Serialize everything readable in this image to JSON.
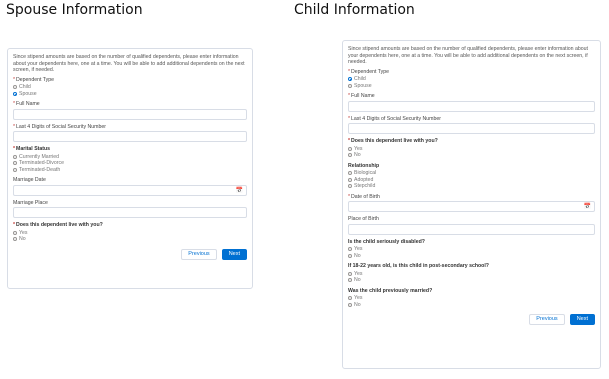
{
  "spouse": {
    "heading": "Spouse Information",
    "intro": "Since stipend amounts are based on the number of qualified dependents, please enter information about your dependents here, one at a time. You will be able to add additional dependents on the next screen, if needed.",
    "dependent_type": {
      "label": "Dependent Type",
      "options": [
        "Child",
        "Spouse"
      ],
      "selected": "Spouse"
    },
    "full_name_label": "Full Name",
    "ssn_label": "Last 4 Digits of Social Security Number",
    "marital_status": {
      "label": "Marital Status",
      "options": [
        "Currently Married",
        "Terminated-Divorce",
        "Terminated-Death"
      ]
    },
    "marriage_date_label": "Marriage Date",
    "marriage_place_label": "Marriage Place",
    "lives_with_you": {
      "label": "Does this dependent live with you?",
      "options": [
        "Yes",
        "No"
      ]
    },
    "previous_label": "Previous",
    "next_label": "Next"
  },
  "child": {
    "heading": "Child Information",
    "intro": "Since stipend amounts are based on the number of qualified dependents, please enter information about your dependents here, one at a time. You will be able to add additional dependents on the next screen, if needed.",
    "dependent_type": {
      "label": "Dependent Type",
      "options": [
        "Child",
        "Spouse"
      ],
      "selected": "Child"
    },
    "full_name_label": "Full Name",
    "ssn_label": "Last 4 Digits of Social Security Number",
    "lives_with_you": {
      "label": "Does this dependent live with you?",
      "options": [
        "Yes",
        "No"
      ]
    },
    "relationship": {
      "label": "Relationship",
      "options": [
        "Biological",
        "Adopted",
        "Stepchild"
      ]
    },
    "date_of_birth_label": "Date of Birth",
    "place_of_birth_label": "Place of Birth",
    "seriously_disabled": {
      "label": "Is the child seriously disabled?",
      "options": [
        "Yes",
        "No"
      ]
    },
    "post_secondary": {
      "label": "If 18-22 years old, is this child in post-secondary school?",
      "options": [
        "Yes",
        "No"
      ]
    },
    "previously_married": {
      "label": "Was the child previously married?",
      "options": [
        "Yes",
        "No"
      ]
    },
    "previous_label": "Previous",
    "next_label": "Next"
  },
  "icons": {
    "calendar": "calendar-icon"
  },
  "colors": {
    "brand": "#0070d2",
    "required": "#c23934",
    "border": "#d8dde6"
  }
}
